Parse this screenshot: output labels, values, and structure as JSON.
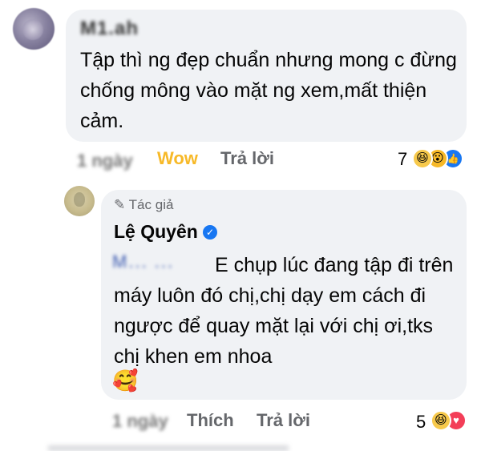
{
  "comment1": {
    "author": "M1.ah",
    "text": "Tập thì ng đẹp chuẩn nhưng mong c đừng chống mông vào mặt ng xem,mất thiện cảm.",
    "time": "1 ngày",
    "reaction_label": "Wow",
    "reply_label": "Trả lời",
    "reaction_count": "7",
    "reactions": [
      "haha",
      "wow",
      "like"
    ]
  },
  "reply": {
    "author_badge": "Tác giả",
    "author": "Lệ Quyên",
    "mention": "M... ...",
    "text": "E chụp lúc đang tập đi trên máy luôn đó chị,chị dạy em cách đi ngược để quay mặt lại với chị ơi,tks chị khen em nhoa",
    "emoji": "🥰",
    "time": "1 ngày",
    "like_label": "Thích",
    "reply_label": "Trả lời",
    "reaction_count": "5",
    "reactions": [
      "haha",
      "love"
    ]
  },
  "colors": {
    "bubble": "#f0f2f5",
    "wow": "#f7b928",
    "action_gray": "#65676b",
    "verified_blue": "#1877f2"
  }
}
